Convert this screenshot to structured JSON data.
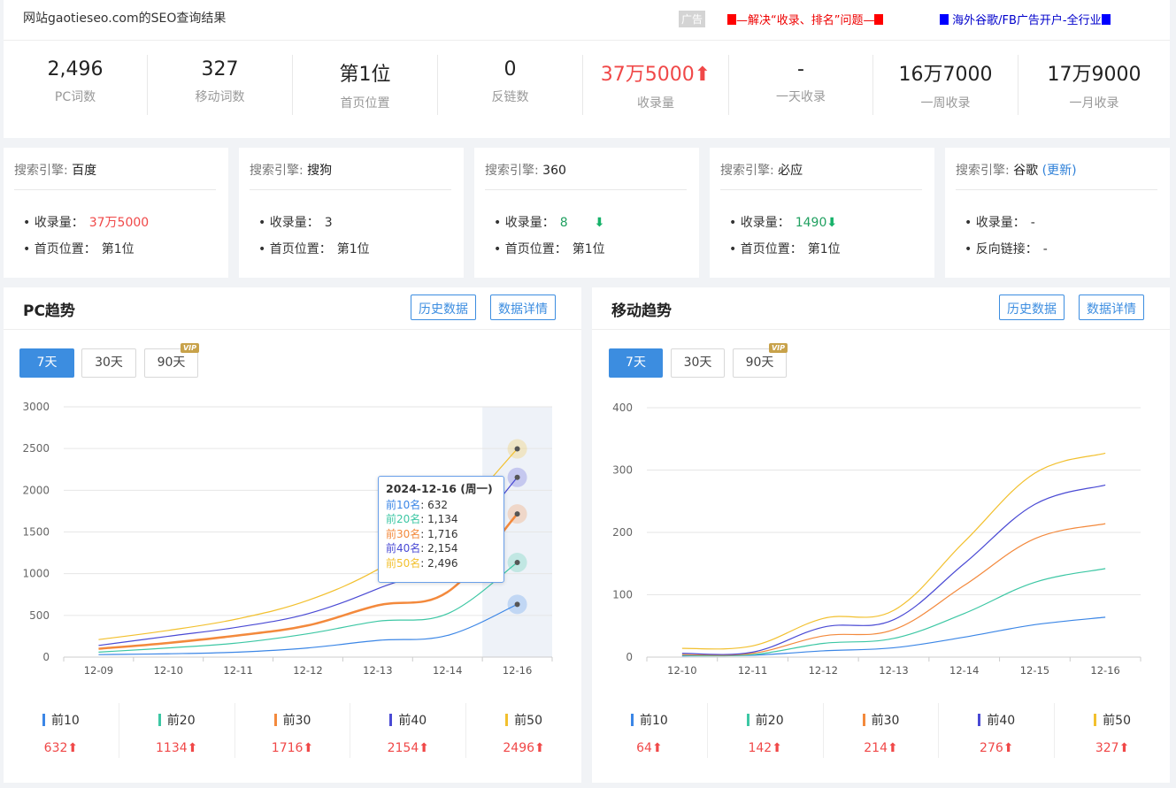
{
  "header": {
    "title": "网站gaotieseo.com的SEO查询结果",
    "ad_tag": "广告",
    "ad1": "—解决“收录、排名”问题—",
    "ad2": "海外谷歌/FB广告开户-全行业"
  },
  "stats": [
    {
      "value": "2,496",
      "label": "PC词数"
    },
    {
      "value": "327",
      "label": "移动词数"
    },
    {
      "value": "第1位",
      "label": "首页位置"
    },
    {
      "value": "0",
      "label": "反链数"
    },
    {
      "value": "37万5000",
      "label": "收录量"
    },
    {
      "value": "-",
      "label": "一天收录"
    },
    {
      "value": "16万7000",
      "label": "一周收录"
    },
    {
      "value": "17万9000",
      "label": "一月收录"
    }
  ],
  "engines": [
    {
      "prefix": "搜索引擎: ",
      "name": "百度",
      "more": "",
      "rows": [
        {
          "label": "收录量：",
          "value": "37万5000"
        },
        {
          "label": "首页位置：",
          "value": "第1位"
        }
      ]
    },
    {
      "prefix": "搜索引擎: ",
      "name": "搜狗",
      "more": "",
      "rows": [
        {
          "label": "收录量：",
          "value": "3"
        },
        {
          "label": "首页位置：",
          "value": "第1位"
        }
      ]
    },
    {
      "prefix": "搜索引擎: ",
      "name": "360",
      "more": "",
      "rows": [
        {
          "label": "收录量：",
          "value": "8"
        },
        {
          "label": "首页位置：",
          "value": "第1位"
        }
      ]
    },
    {
      "prefix": "搜索引擎: ",
      "name": "必应",
      "more": "",
      "rows": [
        {
          "label": "收录量：",
          "value": "1490"
        },
        {
          "label": "首页位置：",
          "value": "第1位"
        }
      ]
    },
    {
      "prefix": "搜索引擎: ",
      "name": "谷歌",
      "more": "(更新)",
      "rows": [
        {
          "label": "收录量：",
          "value": "-"
        },
        {
          "label": "反向链接：",
          "value": "-"
        }
      ]
    }
  ],
  "buttons": {
    "history": "历史数据",
    "details": "数据详情"
  },
  "ranges": [
    "7天",
    "30天",
    "90天"
  ],
  "vip_label": "VIP",
  "colors": [
    "#3b86e6",
    "#3dc7a4",
    "#f3893c",
    "#4a4ad4",
    "#f2c02e"
  ],
  "pc": {
    "title": "PC趋势",
    "legend": [
      {
        "name": "前10",
        "value": "632"
      },
      {
        "name": "前20",
        "value": "1134"
      },
      {
        "name": "前30",
        "value": "1716"
      },
      {
        "name": "前40",
        "value": "2154"
      },
      {
        "name": "前50",
        "value": "2496"
      }
    ]
  },
  "mobile": {
    "title": "移动趋势",
    "legend": [
      {
        "name": "前10",
        "value": "64"
      },
      {
        "name": "前20",
        "value": "142"
      },
      {
        "name": "前30",
        "value": "214"
      },
      {
        "name": "前40",
        "value": "276"
      },
      {
        "name": "前50",
        "value": "327"
      }
    ]
  },
  "tooltip": {
    "title": "2024-12-16 (周一)",
    "rows": [
      {
        "name": "前10名",
        "value": "632"
      },
      {
        "name": "前20名",
        "value": "1,134"
      },
      {
        "name": "前30名",
        "value": "1,716"
      },
      {
        "name": "前40名",
        "value": "2,154"
      },
      {
        "name": "前50名",
        "value": "2,496"
      }
    ]
  },
  "chart_data": [
    {
      "type": "line",
      "x": [
        "12-09",
        "12-10",
        "12-11",
        "12-12",
        "12-13",
        "12-14",
        "12-16"
      ],
      "ylim": [
        0,
        3000
      ],
      "yticks": [
        0,
        500,
        1000,
        1500,
        2000,
        2500,
        3000
      ],
      "series": [
        {
          "name": "前10",
          "values": [
            30,
            40,
            60,
            110,
            200,
            260,
            632
          ]
        },
        {
          "name": "前20",
          "values": [
            60,
            110,
            170,
            280,
            430,
            520,
            1134
          ]
        },
        {
          "name": "前30",
          "values": [
            100,
            170,
            260,
            380,
            620,
            780,
            1716
          ]
        },
        {
          "name": "前40",
          "values": [
            140,
            250,
            360,
            520,
            820,
            1200,
            2154
          ]
        },
        {
          "name": "前50",
          "values": [
            210,
            320,
            460,
            680,
            1050,
            1600,
            2496
          ]
        }
      ]
    },
    {
      "type": "line",
      "x": [
        "12-10",
        "12-11",
        "12-12",
        "12-13",
        "12-14",
        "12-15",
        "12-16"
      ],
      "ylim": [
        0,
        400
      ],
      "yticks": [
        0,
        100,
        200,
        300,
        400
      ],
      "series": [
        {
          "name": "前10",
          "values": [
            2,
            3,
            10,
            15,
            32,
            52,
            64
          ]
        },
        {
          "name": "前20",
          "values": [
            3,
            4,
            22,
            30,
            70,
            120,
            142
          ]
        },
        {
          "name": "前30",
          "values": [
            4,
            6,
            34,
            44,
            115,
            190,
            214
          ]
        },
        {
          "name": "前40",
          "values": [
            6,
            8,
            48,
            60,
            150,
            245,
            276
          ]
        },
        {
          "name": "前50",
          "values": [
            14,
            18,
            62,
            75,
            185,
            295,
            327
          ]
        }
      ]
    }
  ]
}
